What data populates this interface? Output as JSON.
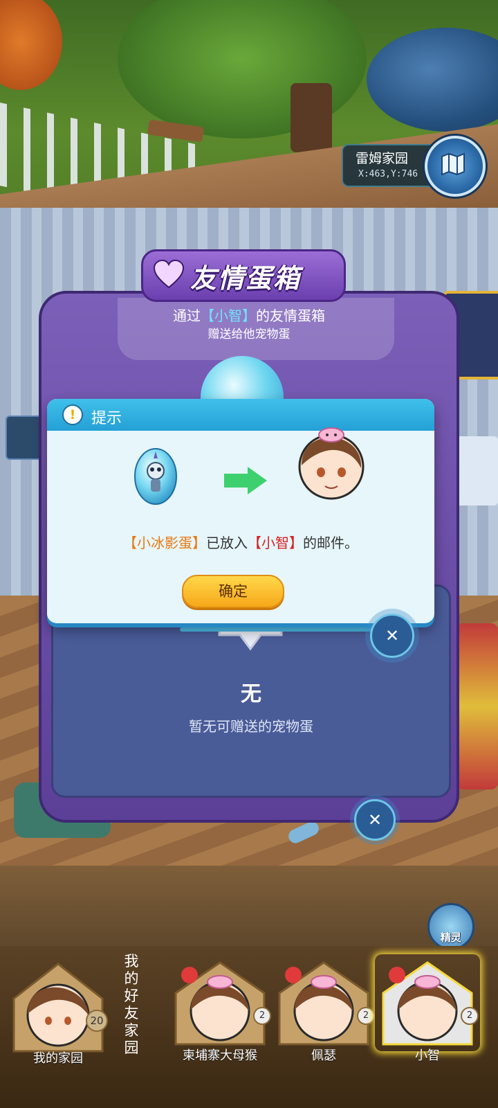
{
  "location": {
    "name": "雷姆家园",
    "coords": "X:463,Y:746"
  },
  "egg_box": {
    "title": "友情蛋箱",
    "line1_prefix": "通过",
    "line1_name": "【小智】",
    "line1_suffix": "的友情蛋箱",
    "line2": "赠送给他宠物蛋",
    "none_label": "无",
    "empty_text": "暂无可赠送的宠物蛋"
  },
  "dialog": {
    "title": "提示",
    "msg_egg": "【小冰影蛋】",
    "msg_mid": "已放入",
    "msg_target": "【小智】",
    "msg_end": "的邮件。",
    "confirm_label": "确定"
  },
  "helper_label": "精灵",
  "bottom_bar": {
    "home": {
      "label": "我的家园",
      "level": "20"
    },
    "friends_label": "我的好友家园",
    "friends": [
      {
        "name": "柬埔寨大母猴",
        "level": "2"
      },
      {
        "name": "佩瑟",
        "level": "2"
      },
      {
        "name": "小智",
        "level": "2",
        "selected": true
      }
    ]
  },
  "colors": {
    "dialog_header": "#3fc0ea",
    "confirm_button": "#f6a81a",
    "highlight_orange": "#e87a10",
    "highlight_red": "#d82020",
    "box_purple": "#6b3fae"
  }
}
